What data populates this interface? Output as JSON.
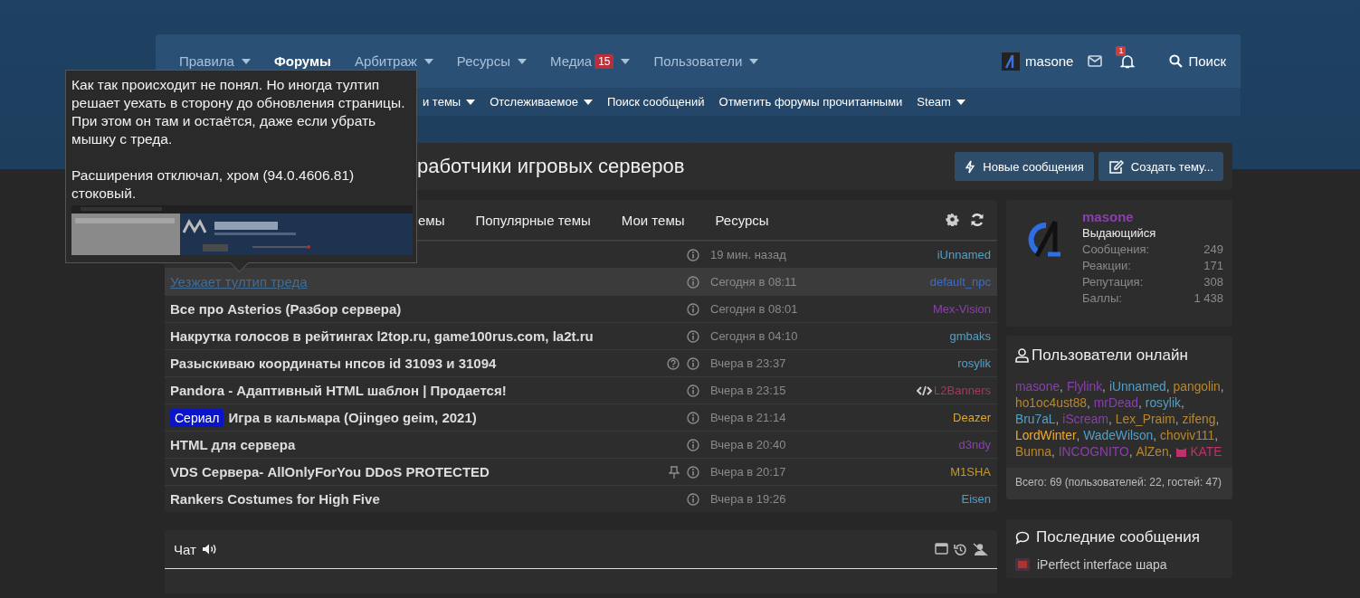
{
  "nav": {
    "items": [
      {
        "label": "Правила",
        "dropdown": true,
        "selected": false
      },
      {
        "label": "Форумы",
        "dropdown": false,
        "selected": true
      },
      {
        "label": "Арбитраж",
        "dropdown": true,
        "selected": false
      },
      {
        "label": "Ресурсы",
        "dropdown": true,
        "selected": false
      },
      {
        "label": "Медиа",
        "badge": "15",
        "dropdown": true,
        "selected": false
      },
      {
        "label": "Пользователи",
        "dropdown": true,
        "selected": false
      }
    ],
    "account": "masone",
    "alerts_badge": "1",
    "search": "Поиск"
  },
  "subnav": [
    {
      "label": "и темы",
      "dropdown": true
    },
    {
      "label": "Отслеживаемое",
      "dropdown": true
    },
    {
      "label": "Поиск сообщений",
      "dropdown": false
    },
    {
      "label": "Отметить форумы прочитанными",
      "dropdown": false
    },
    {
      "label": "Steam",
      "dropdown": true
    }
  ],
  "page_title": "работчики игровых серверов",
  "buttons": [
    {
      "label": "Новые сообщения",
      "kind": "bolt"
    },
    {
      "label": "Создать тему...",
      "kind": "edit"
    }
  ],
  "thread_tabs": [
    {
      "label": "емы"
    },
    {
      "label": "Популярные темы"
    },
    {
      "label": "Мои темы"
    },
    {
      "label": "Ресурсы"
    }
  ],
  "threads": [
    {
      "kind": "plain",
      "hovered": false,
      "question": false,
      "pinned": false,
      "time": "19 мин. назад",
      "user": {
        "name": "iUnnamed",
        "kind": "plain",
        "color": "#4fa0c8"
      }
    },
    {
      "title": "Уезжает тултип треда",
      "kind": "link",
      "hovered": true,
      "question": false,
      "pinned": false,
      "time": "Сегодня в 08:11",
      "user": {
        "name": "default_npc",
        "kind": "plain",
        "color": "#3d6bd0"
      }
    },
    {
      "title": "Все про Asterios (Разбор сервера)",
      "kind": "plain",
      "hovered": false,
      "question": false,
      "pinned": false,
      "time": "Сегодня в 08:01",
      "user": {
        "name": "Mex-Vision",
        "kind": "plain",
        "color": "#8b3fae"
      }
    },
    {
      "title": "Накрутка голосов в рейтингах l2top.ru, game100rus.com, la2t.ru",
      "kind": "plain",
      "hovered": false,
      "question": false,
      "pinned": false,
      "time": "Сегодня в 04:10",
      "user": {
        "name": "gmbaks",
        "kind": "plain",
        "color": "#4fa0c8"
      }
    },
    {
      "title": "Разыскиваю координаты нпсов id 31093 и 31094",
      "kind": "plain",
      "hovered": false,
      "question": true,
      "pinned": false,
      "time": "Вчера в 23:37",
      "user": {
        "name": "rosylik",
        "kind": "plain",
        "color": "#4fa0c8"
      }
    },
    {
      "title": "Pandora - Адаптивный HTML шаблон | Продается!",
      "kind": "plain",
      "hovered": false,
      "question": false,
      "pinned": false,
      "time": "Вчера в 23:15",
      "user": {
        "name": "L2Banners",
        "kind": "coder",
        "color": "#a8385a"
      }
    },
    {
      "title": "Игра в кальмара (Ojingeo geim, 2021)",
      "prefix": "Сериал",
      "kind": "plain",
      "hovered": false,
      "question": false,
      "pinned": false,
      "time": "Вчера в 21:14",
      "user": {
        "name": "Deazer",
        "kind": "plain",
        "color": "#e0a52a"
      }
    },
    {
      "title": "HTML для сервера",
      "kind": "plain",
      "hovered": false,
      "question": false,
      "pinned": false,
      "time": "Вчера в 20:40",
      "user": {
        "name": "d3ndy",
        "kind": "plain",
        "color": "#8b3fae"
      }
    },
    {
      "title": "VDS Сервера- AllOnlyForYou DDoS PROTECTED",
      "kind": "plain",
      "hovered": false,
      "question": false,
      "pinned": true,
      "time": "Вчера в 20:17",
      "user": {
        "name": "M1SHA",
        "kind": "plain",
        "color": "#c29a22"
      }
    },
    {
      "title": "Rankers Costumes for High Five",
      "kind": "plain",
      "hovered": false,
      "question": false,
      "pinned": false,
      "time": "Вчера в 19:26",
      "user": {
        "name": "Eisen",
        "kind": "plain",
        "color": "#4fa0c8"
      }
    }
  ],
  "tooltip": {
    "paragraphs": [
      "Как так происходит не понял. Но иногда тултип решает уехать в сторону до обновления страницы. При этом он там и остаётся, даже если убрать мышку с треда.",
      "Расширения отключал, хром (94.0.4606.81) стоковый."
    ]
  },
  "chat": {
    "title": "Чат"
  },
  "profile": {
    "name": "masone",
    "rank": "Выдающийся",
    "stats": [
      {
        "label": "Сообщения:",
        "value": "249"
      },
      {
        "label": "Реакции:",
        "value": "171"
      },
      {
        "label": "Репутация:",
        "value": "308"
      },
      {
        "label": "Баллы:",
        "value": "1 438"
      }
    ]
  },
  "online": {
    "title": "Пользователи онлайн",
    "separator": ",",
    "users": [
      {
        "name": "masone",
        "kind": "plain",
        "color": "#8b3fae"
      },
      {
        "name": "Flylink",
        "kind": "plain",
        "color": "#8b3fae"
      },
      {
        "name": "iUnnamed",
        "kind": "plain",
        "color": "#4fa0c8"
      },
      {
        "name": "pangolin",
        "kind": "plain",
        "color": "#b8872c"
      },
      {
        "name": "ho1oc4ust88",
        "kind": "plain",
        "color": "#b8872c"
      },
      {
        "name": "mrDead",
        "kind": "plain",
        "color": "#8b3fae"
      },
      {
        "name": "rosylik",
        "kind": "plain",
        "color": "#4fa0c8"
      },
      {
        "name": "Bru7aL",
        "kind": "plain",
        "color": "#4fa0c8"
      },
      {
        "name": "iScream",
        "kind": "plain",
        "color": "#8b3fae"
      },
      {
        "name": "Lex_Praim",
        "kind": "plain",
        "color": "#b8872c"
      },
      {
        "name": "zifeng",
        "kind": "plain",
        "color": "#b8872c"
      },
      {
        "name": "LordWinter",
        "kind": "plain",
        "color": "#f0a832"
      },
      {
        "name": "WadeWilson",
        "kind": "plain",
        "color": "#4fa0c8"
      },
      {
        "name": "choviv111",
        "kind": "plain",
        "color": "#b8872c"
      },
      {
        "name": "Bunna",
        "kind": "plain",
        "color": "#b8872c"
      },
      {
        "name": "INCOGNITO",
        "kind": "plain",
        "color": "#8b3fae"
      },
      {
        "name": "AlZen",
        "kind": "plain",
        "color": "#b8872c"
      },
      {
        "name": "KATE",
        "kind": "badged",
        "color": "#c0306a"
      }
    ],
    "total": "Всего: 69 (пользователей: 22, гостей: 47)"
  },
  "last_posts": {
    "title": "Последние сообщения",
    "items": [
      {
        "title": "iPerfect interface шара"
      }
    ]
  }
}
